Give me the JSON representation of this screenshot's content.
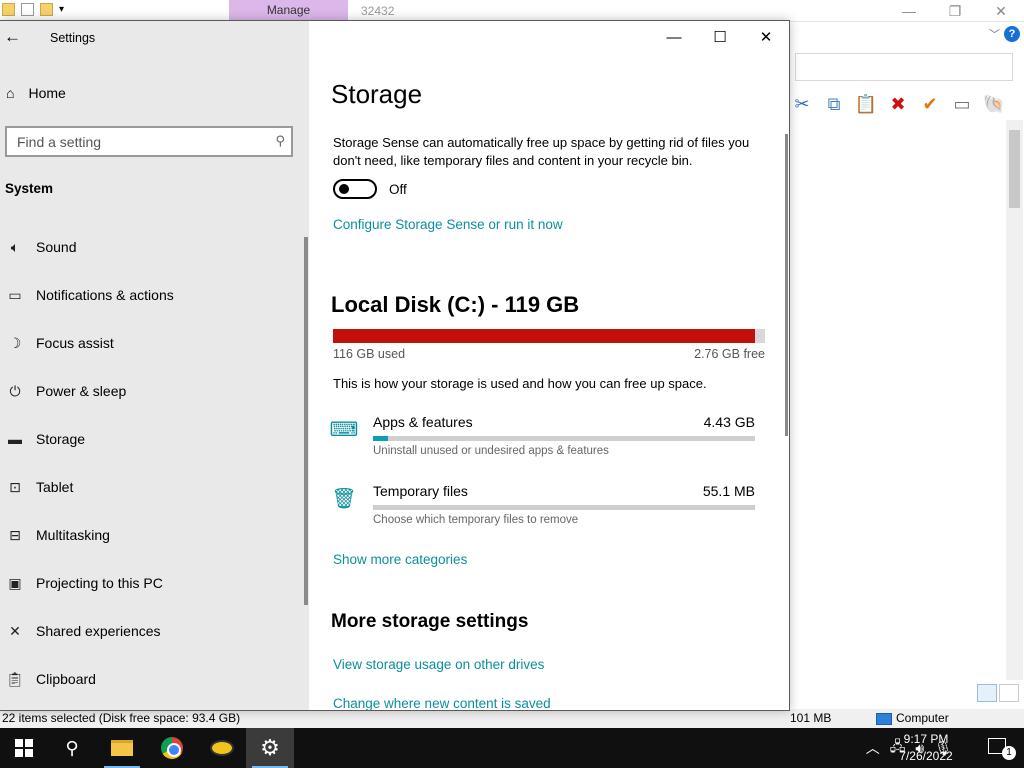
{
  "background_window": {
    "ribbon_tab": "Manage",
    "title": "32432",
    "status_left": "22 items selected (Disk free space: 93.4 GB)",
    "status_size": "101 MB",
    "status_location": "Computer",
    "controls": {
      "minimize": "—",
      "restore": "❐",
      "close": "✕"
    },
    "help": "?"
  },
  "settings": {
    "app_title": "Settings",
    "window_controls": {
      "minimize": "—",
      "maximize": "☐",
      "close": "✕"
    },
    "sidebar": {
      "home": "Home",
      "search_placeholder": "Find a setting",
      "section": "System",
      "items": [
        {
          "label": "Sound",
          "icon": "speaker-icon"
        },
        {
          "label": "Notifications & actions",
          "icon": "message-icon"
        },
        {
          "label": "Focus assist",
          "icon": "moon-icon"
        },
        {
          "label": "Power & sleep",
          "icon": "power-icon"
        },
        {
          "label": "Storage",
          "icon": "storage-icon"
        },
        {
          "label": "Tablet",
          "icon": "tablet-icon"
        },
        {
          "label": "Multitasking",
          "icon": "multitasking-icon"
        },
        {
          "label": "Projecting to this PC",
          "icon": "projector-icon"
        },
        {
          "label": "Shared experiences",
          "icon": "shared-icon"
        },
        {
          "label": "Clipboard",
          "icon": "clipboard-icon"
        }
      ]
    },
    "storage": {
      "title": "Storage",
      "sense_description": "Storage Sense can automatically free up space by getting rid of files you don't need, like temporary files and content in your recycle bin.",
      "toggle_state": "Off",
      "configure_link": "Configure Storage Sense or run it now",
      "disk": {
        "title": "Local Disk (C:) - 119 GB",
        "used": "116 GB used",
        "free": "2.76 GB free",
        "used_fraction": 0.977,
        "bar_color": "#c50f0f"
      },
      "usage_description": "This is how your storage is used and how you can free up space.",
      "categories": [
        {
          "name": "Apps & features",
          "size": "4.43 GB",
          "description": "Uninstall unused or undesired apps & features",
          "fraction": 0.04
        },
        {
          "name": "Temporary files",
          "size": "55.1 MB",
          "description": "Choose which temporary files to remove",
          "fraction": 0.0
        }
      ],
      "show_more": "Show more categories",
      "more_title": "More storage settings",
      "more_links": {
        "other_drives": "View storage usage on other drives",
        "change_location": "Change where new content is saved"
      },
      "accent": "#0b8f9c"
    }
  },
  "taskbar": {
    "time": "9:17 PM",
    "date": "7/26/2022",
    "notification_count": "1"
  }
}
